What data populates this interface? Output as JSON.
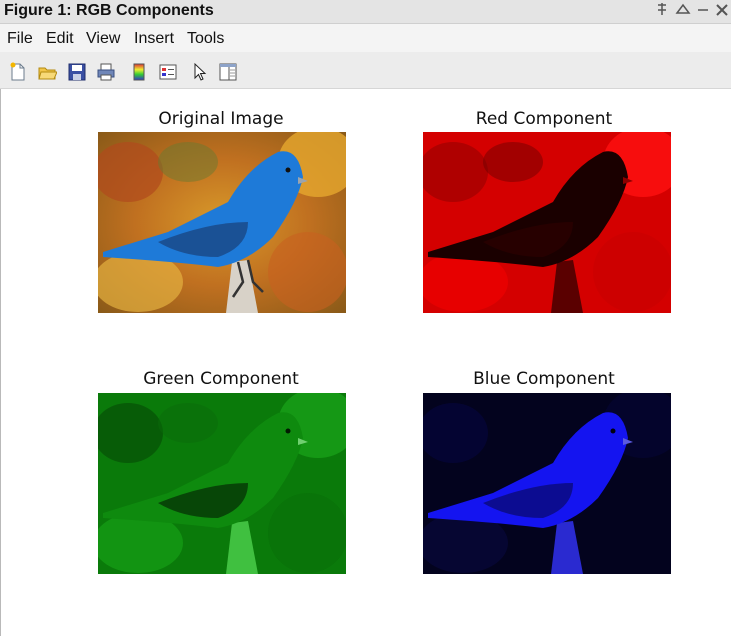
{
  "window": {
    "title": "Figure 1: RGB Components",
    "controls": {
      "pin": "pin-icon",
      "undock": "undock-icon",
      "minimize": "minimize-icon",
      "close": "close-icon"
    }
  },
  "menu": {
    "items": [
      "File",
      "Edit",
      "View",
      "Insert",
      "Tools"
    ]
  },
  "toolbar": {
    "icons": [
      "new-figure-icon",
      "open-file-icon",
      "save-icon",
      "print-icon",
      "colorbar-icon",
      "legend-icon",
      "pointer-icon",
      "property-editor-icon"
    ]
  },
  "figure": {
    "panels": [
      {
        "title": "Original Image",
        "channel": "original"
      },
      {
        "title": "Red Component",
        "channel": "red"
      },
      {
        "title": "Green Component",
        "channel": "green"
      },
      {
        "title": "Blue Component",
        "channel": "blue"
      }
    ]
  }
}
